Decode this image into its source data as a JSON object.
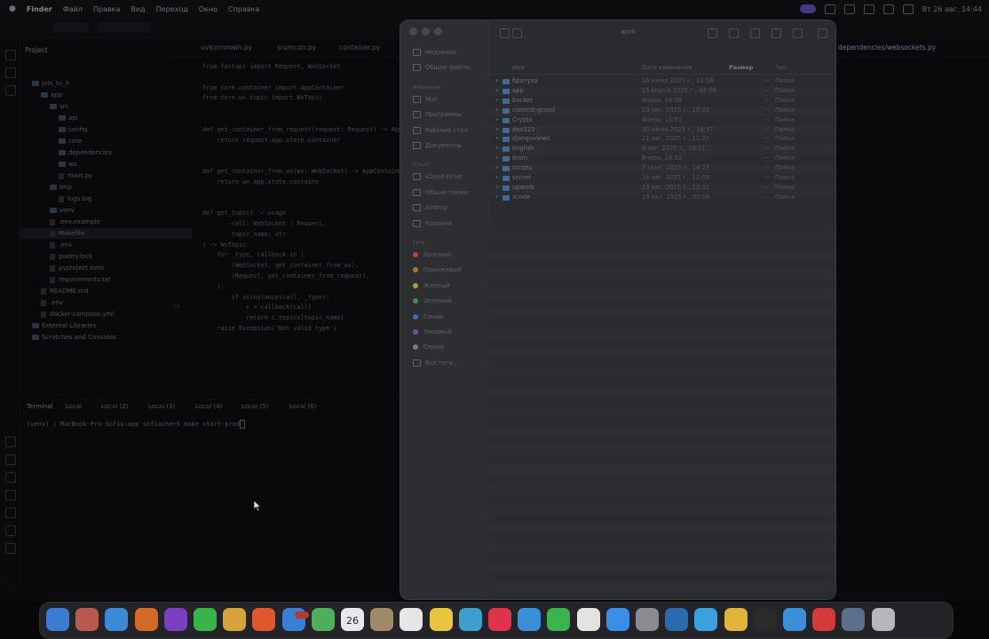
{
  "menubar": {
    "apple": "",
    "items": [
      "Finder",
      "Файл",
      "Правка",
      "Вид",
      "Переход",
      "Окно",
      "Справка"
    ],
    "clock": "Вт 26 авг. 14:44"
  },
  "ide": {
    "project_label": "Project",
    "tree": [
      {
        "label": "join_to_it",
        "depth": 0,
        "type": "folder"
      },
      {
        "label": "app",
        "depth": 1,
        "type": "folder"
      },
      {
        "label": "src",
        "depth": 2,
        "type": "folder"
      },
      {
        "label": "api",
        "depth": 3,
        "type": "folder"
      },
      {
        "label": "config",
        "depth": 3,
        "type": "folder"
      },
      {
        "label": "core",
        "depth": 3,
        "type": "folder"
      },
      {
        "label": "dependencies",
        "depth": 3,
        "type": "folder"
      },
      {
        "label": "ws",
        "depth": 3,
        "type": "folder"
      },
      {
        "label": "main.py",
        "depth": 3,
        "type": "file"
      },
      {
        "label": "tmp",
        "depth": 2,
        "type": "folder"
      },
      {
        "label": "logs.log",
        "depth": 3,
        "type": "file"
      },
      {
        "label": "venv",
        "depth": 2,
        "type": "folder"
      },
      {
        "label": ".env.example",
        "depth": 2,
        "type": "file"
      },
      {
        "label": "Makefile",
        "depth": 2,
        "type": "file",
        "selected": true
      },
      {
        "label": ".env",
        "depth": 2,
        "type": "file"
      },
      {
        "label": "poetry.lock",
        "depth": 2,
        "type": "file"
      },
      {
        "label": "pyproject.toml",
        "depth": 2,
        "type": "file"
      },
      {
        "label": "requirements.txt",
        "depth": 2,
        "type": "file"
      },
      {
        "label": "README.md",
        "depth": 1,
        "type": "file"
      },
      {
        "label": ".env",
        "depth": 1,
        "type": "file"
      },
      {
        "label": "docker-compose.yml",
        "depth": 1,
        "type": "file"
      },
      {
        "label": "External Libraries",
        "depth": 0,
        "type": "folder"
      },
      {
        "label": "Scratches and Consoles",
        "depth": 0,
        "type": "folder"
      }
    ],
    "tabs": [
      "uvicornmain.py",
      "srumcon.py",
      "container.py",
      "dependencies/websockets.py"
    ],
    "code": [
      {
        "n": "",
        "text": "from fastapi import Request, WebSocket"
      },
      {
        "n": "",
        "text": ""
      },
      {
        "n": "",
        "text": "from core.container import AppContainer"
      },
      {
        "n": "",
        "text": "from core.ws.topic import WsTopic"
      },
      {
        "n": "",
        "text": ""
      },
      {
        "n": "",
        "text": ""
      },
      {
        "n": "",
        "text": "def get_container_from_request(request: Request) -> AppCo"
      },
      {
        "n": "",
        "text": "    return request.app.state.container"
      },
      {
        "n": "",
        "text": ""
      },
      {
        "n": "",
        "text": ""
      },
      {
        "n": "",
        "text": "def get_container_from_ws(ws: WebSocket) -> AppContainer"
      },
      {
        "n": "",
        "text": "    return ws.app.state.containe"
      },
      {
        "n": "",
        "text": ""
      },
      {
        "n": "",
        "text": ""
      },
      {
        "n": "",
        "text": "def get_topic(  ✓ usage"
      },
      {
        "n": "",
        "text": "        call: WebSocket | Request,"
      },
      {
        "n": "",
        "text": "        topic_name: str"
      },
      {
        "n": "",
        "text": ") -> WsTopic:"
      },
      {
        "n": "",
        "text": "    for _type, callback in ("
      },
      {
        "n": "",
        "text": "        (WebSocket, get_container_from_ws),"
      },
      {
        "n": "",
        "text": "        (Request, get_container_from_request),"
      },
      {
        "n": "",
        "text": "    ):"
      },
      {
        "n": "",
        "text": "        if isinstance(call, _type):"
      },
      {
        "n": "26",
        "text": "            c = callback(call)"
      },
      {
        "n": "",
        "text": "            return c.topics[topic_name]"
      },
      {
        "n": "",
        "text": "    raise Exception('Not valid type')"
      }
    ],
    "bottom_tabs": [
      "Terminal",
      "Local",
      "Local (2)",
      "Local (3)",
      "Local (4)",
      "Local (5)",
      "Local (6)"
    ],
    "terminal_prompt": "(venv) ) MacBook-Pro-Sofia:app sofiacher$ make start-prod"
  },
  "finder": {
    "title": "work",
    "sidebar_sections": [
      {
        "label": "",
        "items": [
          "Недавние",
          "Общие файлы"
        ]
      },
      {
        "label": "Избранное",
        "items": [
          "Mail",
          "Программы",
          "Рабочий стол",
          "Документы"
        ]
      },
      {
        "label": "iCloud",
        "items": [
          "iCloud Drive",
          "Общие папки",
          "Airdrop",
          "Корзина"
        ]
      },
      {
        "label": "Теги",
        "items": [
          "Красный",
          "Оранжевый",
          "Желтый",
          "Зеленый",
          "Синий",
          "Лиловый",
          "Серый",
          "Все теги..."
        ]
      }
    ],
    "tag_colors": [
      "#b8473f",
      "#b86e2f",
      "#b39a35",
      "#3f8e4a",
      "#3d6fb1",
      "#7d4fa0",
      "#777a80"
    ],
    "columns": {
      "name": "Имя",
      "date": "Дата изменения",
      "size": "Размер",
      "kind": "Тип"
    },
    "rows": [
      {
        "name": "братуха",
        "date": "16 июня 2025 г., 23:58",
        "size": "--",
        "kind": "Папка"
      },
      {
        "name": "app",
        "date": "15 марта 2025 г., 02:08",
        "size": "--",
        "kind": "Папка"
      },
      {
        "name": "backet",
        "date": "Вчера, 16:08",
        "size": "--",
        "kind": "Папка"
      },
      {
        "name": "commit-grand",
        "date": "23 авг. 2025 г., 10:22",
        "size": "--",
        "kind": "Папка"
      },
      {
        "name": "Crypto",
        "date": "Вчера, 15:53",
        "size": "--",
        "kind": "Папка"
      },
      {
        "name": "dex223",
        "date": "30 июня 2025 г., 16:57",
        "size": "--",
        "kind": "Папка"
      },
      {
        "name": "djangoviews",
        "date": "21 авг. 2025 г., 11:21",
        "size": "--",
        "kind": "Папка"
      },
      {
        "name": "english",
        "date": "8 авг. 2025 г., 19:21",
        "size": "--",
        "kind": "Папка"
      },
      {
        "name": "learn",
        "date": "Вчера, 16:53",
        "size": "--",
        "kind": "Папка"
      },
      {
        "name": "scripts",
        "date": "7 сент. 2025 г., 14:27",
        "size": "--",
        "kind": "Папка"
      },
      {
        "name": "secret",
        "date": "16 авг. 2025 г., 12:09",
        "size": "--",
        "kind": "Папка"
      },
      {
        "name": "upwork",
        "date": "23 авг. 2025 г., 13:31",
        "size": "--",
        "kind": "Папка"
      },
      {
        "name": "xcode",
        "date": "18 окт. 2025 г., 00:06",
        "size": "--",
        "kind": "Папка"
      }
    ]
  },
  "dock": {
    "calendar_day": "26",
    "apps": [
      {
        "name": "finder",
        "color": "#3b7bd0"
      },
      {
        "name": "launchpad",
        "color": "#b85a4d"
      },
      {
        "name": "safari",
        "color": "#3b8ad6"
      },
      {
        "name": "firefox",
        "color": "#d46a2a"
      },
      {
        "name": "tor",
        "color": "#7a3fbf"
      },
      {
        "name": "messages",
        "color": "#3ab34a"
      },
      {
        "name": "photos",
        "color": "#d6a43a"
      },
      {
        "name": "swift",
        "color": "#e0562e"
      },
      {
        "name": "mail",
        "color": "#3a7fd6"
      },
      {
        "name": "maps",
        "color": "#4fae5c"
      },
      {
        "name": "calendar",
        "color": "#e8e8ea"
      },
      {
        "name": "contacts",
        "color": "#a08a6a"
      },
      {
        "name": "reminders",
        "color": "#e6e6e6"
      },
      {
        "name": "notes",
        "color": "#e8c440"
      },
      {
        "name": "freeform",
        "color": "#3e9fcf"
      },
      {
        "name": "music",
        "color": "#e0324a"
      },
      {
        "name": "keynote",
        "color": "#3a8fd6"
      },
      {
        "name": "numbers",
        "color": "#3bb34e"
      },
      {
        "name": "pages",
        "color": "#e3e3e3"
      },
      {
        "name": "app-store",
        "color": "#3a8ee6"
      },
      {
        "name": "system-settings",
        "color": "#8a8c92"
      },
      {
        "name": "vpn",
        "color": "#2b6bb0"
      },
      {
        "name": "telegram",
        "color": "#3aa1dd"
      },
      {
        "name": "chrome",
        "color": "#e0b43a"
      },
      {
        "name": "pycharm",
        "color": "#2a2a2a"
      },
      {
        "name": "docker",
        "color": "#3a8fd6"
      },
      {
        "name": "postman",
        "color": "#d43a3a"
      },
      {
        "name": "preview",
        "color": "#5a6f8a"
      },
      {
        "name": "trash",
        "color": "#b5b7bc"
      }
    ]
  }
}
